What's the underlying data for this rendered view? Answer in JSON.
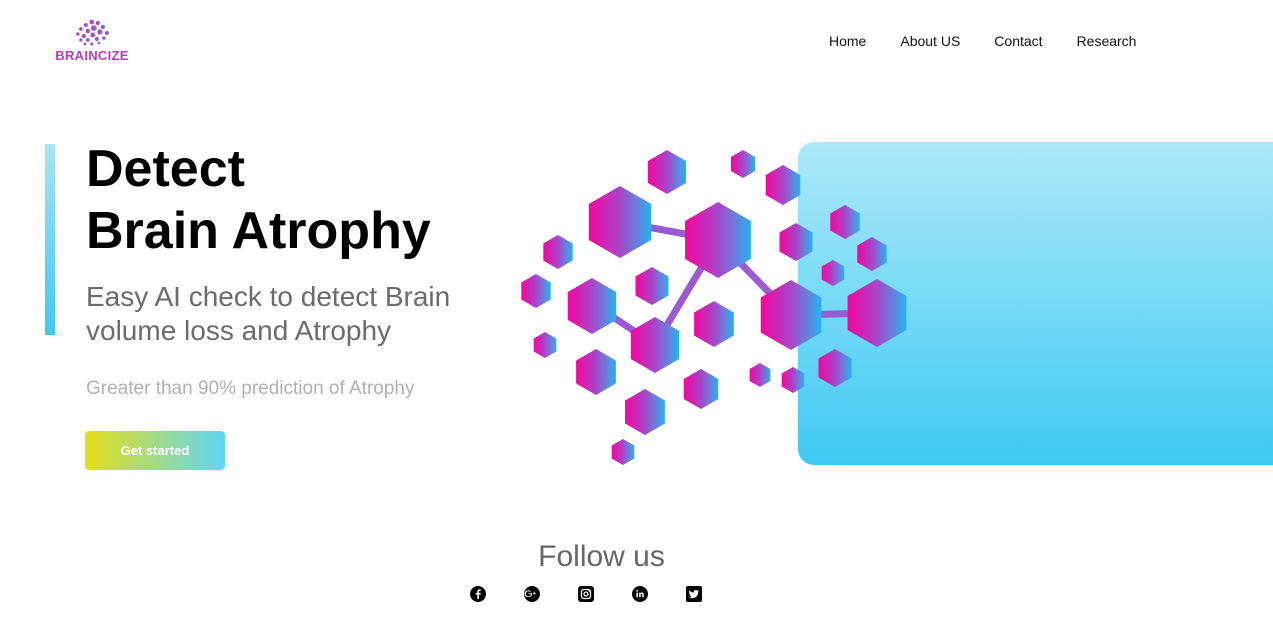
{
  "brand": {
    "name": "BRAINCIZE",
    "color": "#b63cc4"
  },
  "nav": {
    "items": [
      {
        "label": "Home"
      },
      {
        "label": "About US"
      },
      {
        "label": "Contact"
      },
      {
        "label": "Research"
      }
    ]
  },
  "hero": {
    "title_line1": "Detect",
    "title_line2": "Brain Atrophy",
    "subtitle": "Easy AI check to detect Brain volume loss and Atrophy",
    "tagline": "Greater than 90% prediction of Atrophy",
    "cta_label": "Get started",
    "accent_colors": [
      "#e5df17",
      "#5fd6f5",
      "#3ec9f4",
      "#ec0aa3",
      "#7a6bd8"
    ]
  },
  "footer": {
    "follow_title": "Follow us",
    "social": [
      "facebook-icon",
      "google-plus-icon",
      "instagram-icon",
      "linkedin-icon",
      "twitter-icon"
    ]
  }
}
